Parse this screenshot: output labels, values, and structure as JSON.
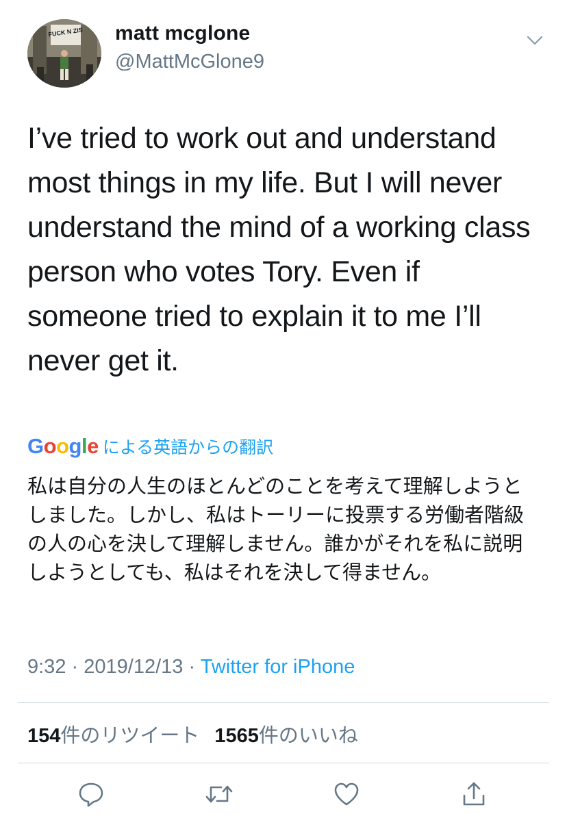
{
  "user": {
    "name": "matt mcglone",
    "handle": "@MattMcGlone9",
    "avatar_sign_text": "FUCK N ZIS"
  },
  "tweet": {
    "text": "I’ve tried to work out and understand most things in my life. But I will never understand the mind of a working class person who votes Tory. Even if someone tried to explain it to me I’ll never get it.",
    "translation_logo": "Google",
    "translation_label": "による英語からの翻訳",
    "translated_text": "私は自分の人生のほとんどのことを考えて理解しようとしました。しかし、私はトーリーに投票する労働者階級の人の心を決して理解しません。誰かがそれを私に説明しようとしても、私はそれを決して得ません。",
    "time": "9:32",
    "date": "2019/12/13",
    "separator": "·",
    "source": "Twitter for iPhone"
  },
  "stats": {
    "retweets_count": "154",
    "retweets_label": "件のリツイート",
    "likes_count": "1565",
    "likes_label": "件のいいね"
  },
  "icons": {
    "menu": "chevron-down-icon",
    "reply": "reply-icon",
    "retweet": "retweet-icon",
    "like": "heart-icon",
    "share": "share-icon"
  },
  "colors": {
    "text": "#14171a",
    "secondary": "#657786",
    "link": "#1da1f2",
    "divider": "#ccd6dd"
  }
}
